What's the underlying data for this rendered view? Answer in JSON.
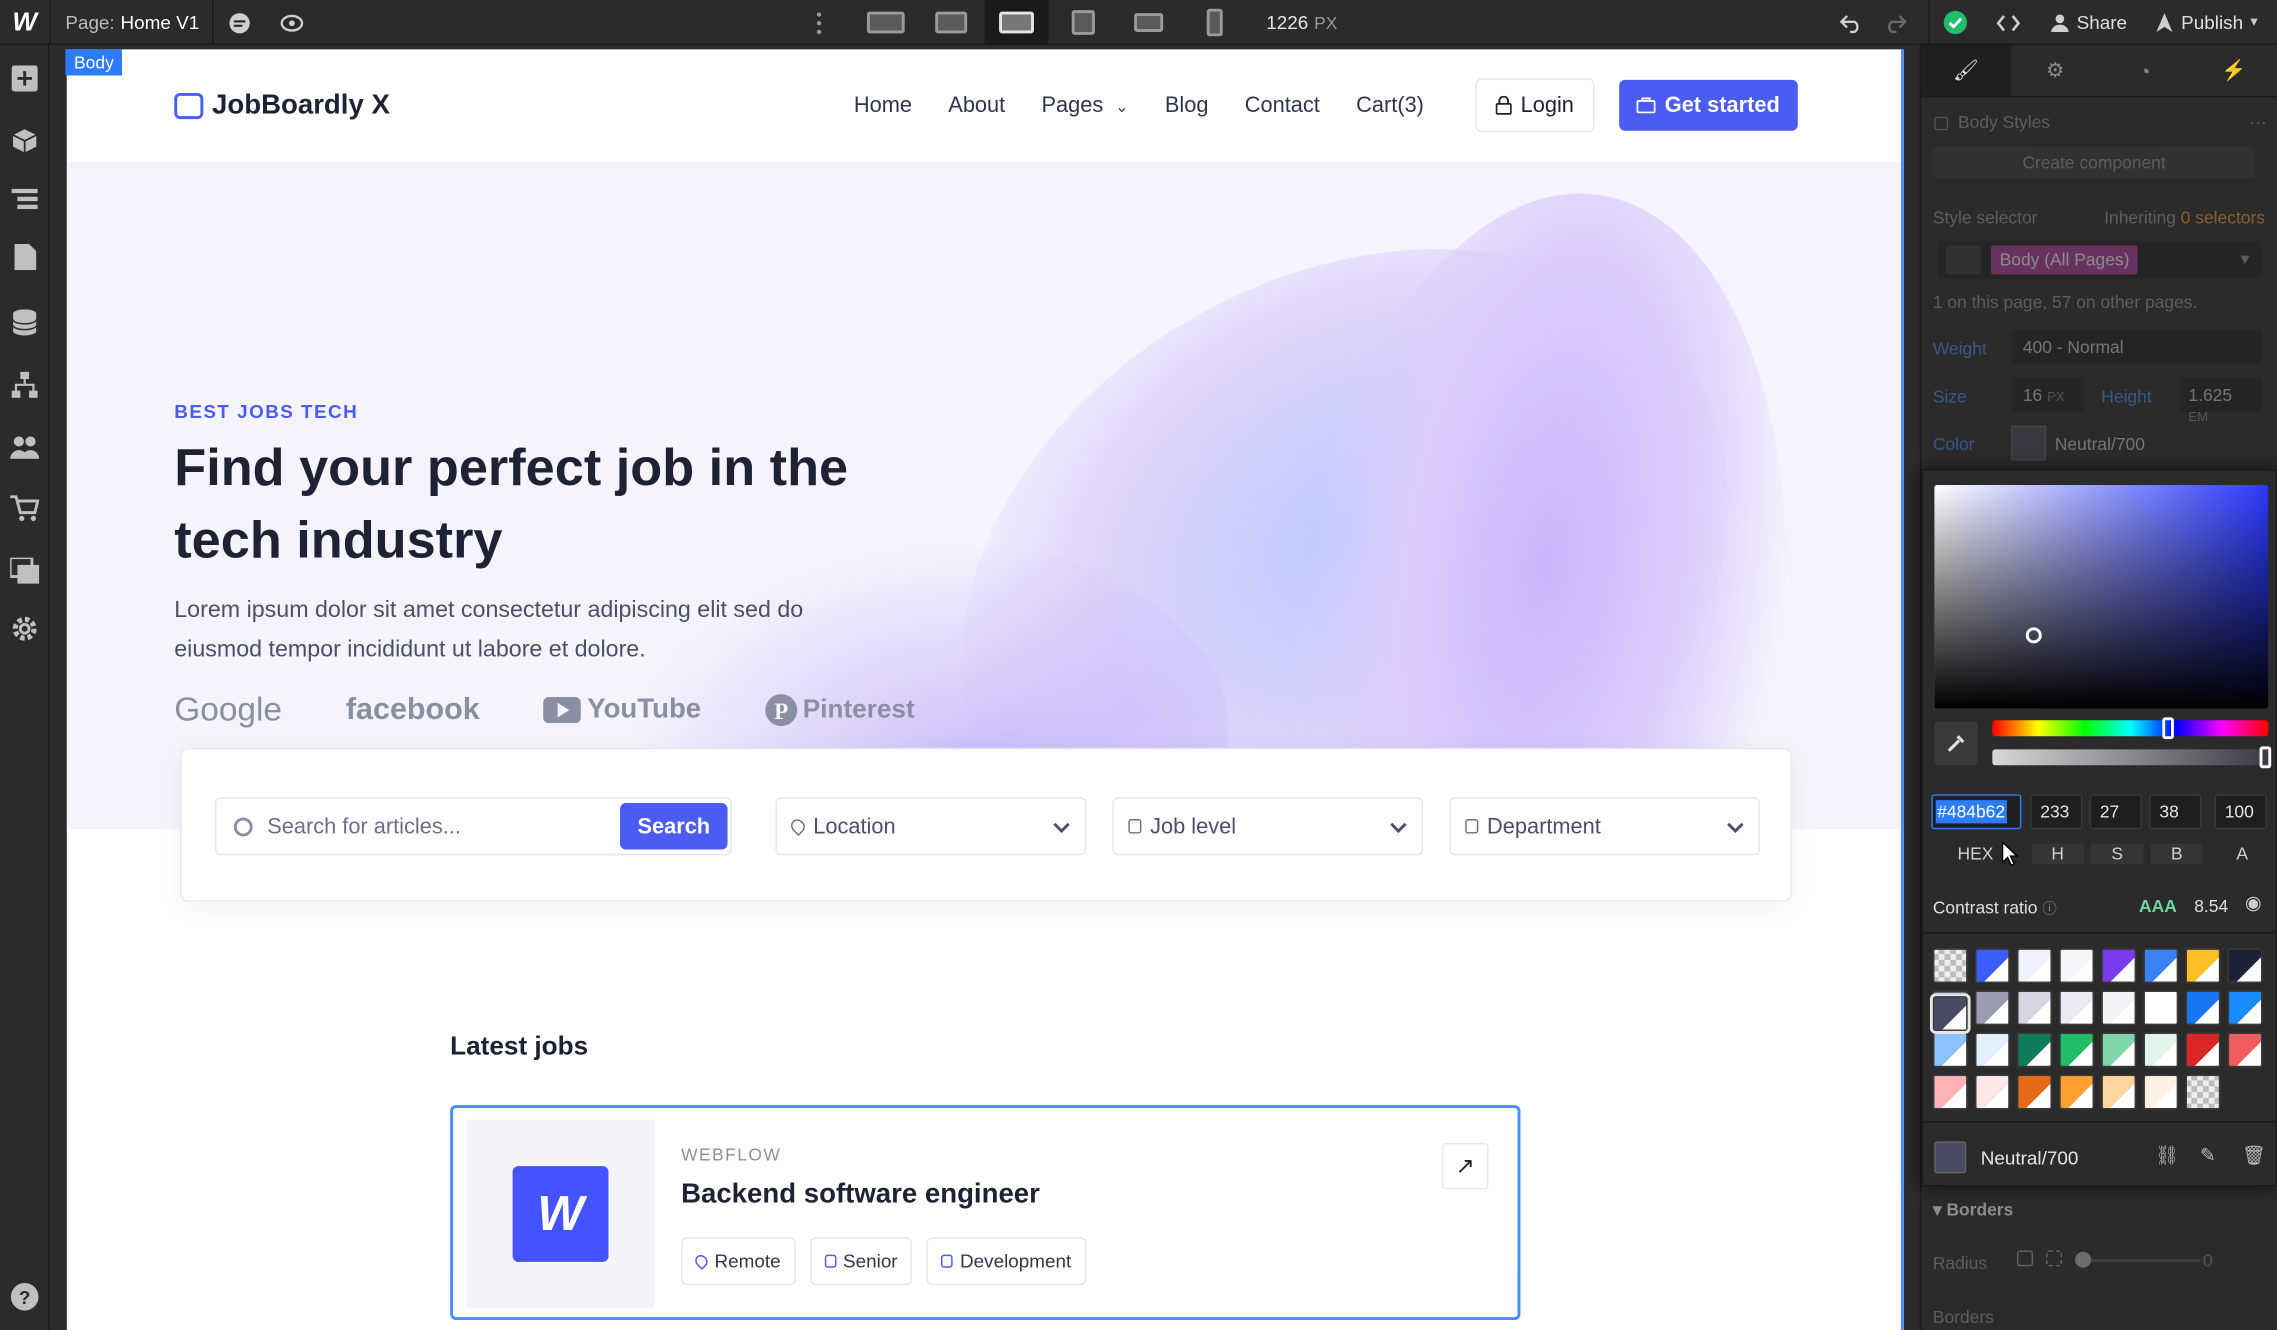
{
  "topbar": {
    "page_label": "Page:",
    "page_name": "Home V1",
    "width_value": "1226",
    "width_unit": "PX",
    "share_label": "Share",
    "publish_label": "Publish"
  },
  "canvas": {
    "body_tag": "Body",
    "nav": {
      "brand": "JobBoardly X",
      "links": [
        "Home",
        "About",
        "Pages",
        "Blog",
        "Contact",
        "Cart(3)"
      ],
      "login": "Login",
      "cta": "Get started"
    },
    "hero": {
      "eyebrow": "BEST JOBS TECH",
      "title": "Find your perfect job in the tech industry",
      "lead": "Lorem ipsum dolor sit amet consectetur adipiscing elit sed do eiusmod tempor incididunt ut labore et dolore.",
      "logos": [
        "Google",
        "facebook",
        "YouTube",
        "Pinterest"
      ]
    },
    "search": {
      "placeholder": "Search for articles...",
      "button": "Search",
      "location": "Location",
      "job_level": "Job level",
      "department": "Department"
    },
    "latest_jobs": {
      "heading": "Latest jobs",
      "jobs": [
        {
          "logo_letter": "W",
          "company": "WEBFLOW",
          "title": "Backend software engineer",
          "tags": [
            "Remote",
            "Senior",
            "Development"
          ]
        }
      ]
    }
  },
  "panel": {
    "body_styles": "Body Styles",
    "create_component": "Create component",
    "style_selector": "Style selector",
    "inheriting": "Inheriting",
    "inheriting_count": "0 selectors",
    "selector_value": "Body (All Pages)",
    "selector_note": "1 on this page, 57 on other pages.",
    "weight_label": "Weight",
    "weight_value": "400 - Normal",
    "size_label": "Size",
    "size_value": "16",
    "size_unit": "PX",
    "height_label": "Height",
    "height_value": "1.625",
    "height_unit": "EM",
    "color_label": "Color",
    "color_value": "Neutral/700",
    "borders_section": "Borders",
    "radius_label": "Radius",
    "radius_value": "0",
    "borders_label": "Borders"
  },
  "picker": {
    "hex": "#484b62",
    "h": "233",
    "s": "27",
    "b": "38",
    "a": "100",
    "labels": [
      "HEX",
      "H",
      "S",
      "B",
      "A"
    ],
    "contrast_label": "Contrast ratio",
    "contrast_grade": "AAA",
    "contrast_value": "8.54",
    "swatch_name": "Neutral/700",
    "swatches": [
      "transparent",
      "#3b5bfd",
      "#eef0fb",
      "#f5f5fb",
      "#7c3aed",
      "#3b82f6",
      "#fbbf24",
      "#1e2235",
      "#484b62",
      "#6b6f86",
      "#9a9db0",
      "#d5d6e2",
      "#e9eaf2",
      "#f4f4f8",
      "#ffffff",
      "#1877f2",
      "#1a8cff",
      "#8cc2ff",
      "#e3f0ff",
      "#0f7b5a",
      "#1fbf6a",
      "#7fd6a8",
      "#e2f5ea",
      "#dc2626",
      "#f25c5c",
      "#ffb3b8",
      "#fde7e7",
      "#e56a1a",
      "#ff9f2e",
      "#ffd59e",
      "#fff0e4",
      "transparent"
    ]
  }
}
